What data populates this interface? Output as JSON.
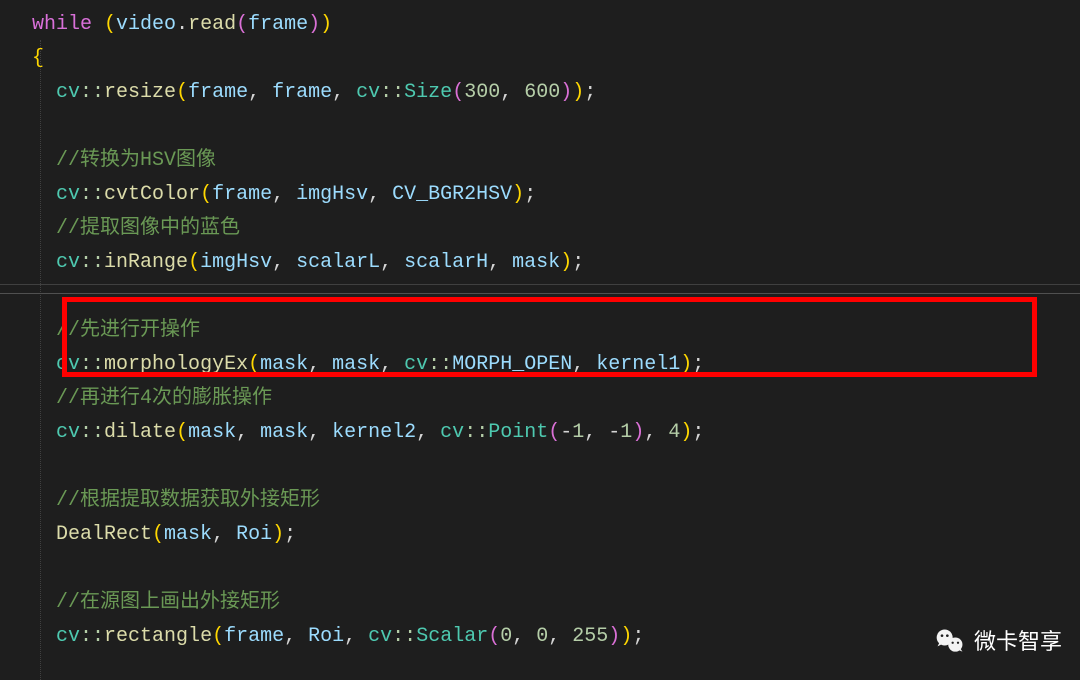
{
  "code": {
    "line1_while": "while",
    "line1_rest": " (video.read(frame))",
    "line2": "  {",
    "line3_ns": "cv",
    "line3_func": "resize",
    "line3_args": "(frame, frame, ",
    "line3_size": "Size",
    "line3_nums": "(300, 600))",
    "line3_semi": ";",
    "line5_comment": "//转换为HSV图像",
    "line6_func": "cvtColor",
    "line6_args": "(frame, imgHsv, CV_BGR2HSV)",
    "line7_comment": "//提取图像中的蓝色",
    "line8_func": "inRange",
    "line8_args": "(imgHsv, scalarL, scalarH, mask)",
    "line10_comment": "//先进行开操作",
    "line11_func": "morphologyEx",
    "line11_args": "(mask, mask, ",
    "line11_const": "MORPH_OPEN",
    "line11_rest": ", kernel1)",
    "line12_comment": "//再进行4次的膨胀操作",
    "line13_func": "dilate",
    "line13_args": "(mask, mask, kernel2, ",
    "line13_point": "Point",
    "line13_pargs": "(-1, -1)",
    "line13_rest": ", 4)",
    "line15_comment": "//根据提取数据获取外接矩形",
    "line16_func": "DealRect",
    "line16_args": "(mask, Roi)",
    "line18_comment": "//在源图上画出外接矩形",
    "line19_func": "rectangle",
    "line19_args": "(frame, Roi, ",
    "line19_scalar": "Scalar",
    "line19_sargs": "(0, 0, 255))"
  },
  "watermark": "微卡智享"
}
